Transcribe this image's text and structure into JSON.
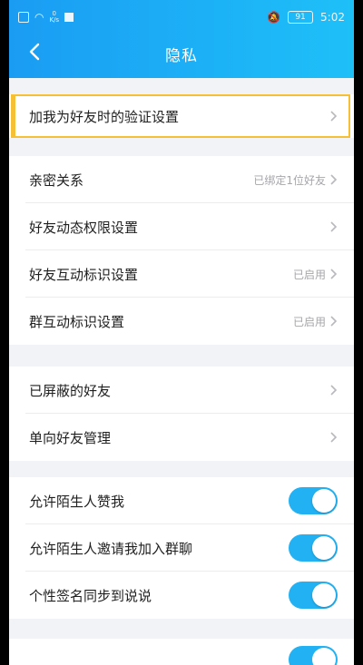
{
  "status_bar": {
    "network_speed": "0\nK/s",
    "battery": "91",
    "time": "5:02"
  },
  "header": {
    "title": "隐私"
  },
  "groups": {
    "verify": {
      "items": [
        {
          "label": "加我为好友时的验证设置",
          "value": ""
        }
      ]
    },
    "relations": {
      "items": [
        {
          "label": "亲密关系",
          "value": "已绑定1位好友"
        },
        {
          "label": "好友动态权限设置",
          "value": ""
        },
        {
          "label": "好友互动标识设置",
          "value": "已启用"
        },
        {
          "label": "群互动标识设置",
          "value": "已启用"
        }
      ]
    },
    "friends": {
      "items": [
        {
          "label": "已屏蔽的好友",
          "value": ""
        },
        {
          "label": "单向好友管理",
          "value": ""
        }
      ]
    },
    "toggles": {
      "items": [
        {
          "label": "允许陌生人赞我",
          "on": true
        },
        {
          "label": "允许陌生人邀请我加入群聊",
          "on": true
        },
        {
          "label": "个性签名同步到说说",
          "on": true
        }
      ]
    }
  },
  "colors": {
    "accent": "#1fb0f5",
    "highlight": "#f5c036",
    "toggle_on": "#22b1f2"
  }
}
